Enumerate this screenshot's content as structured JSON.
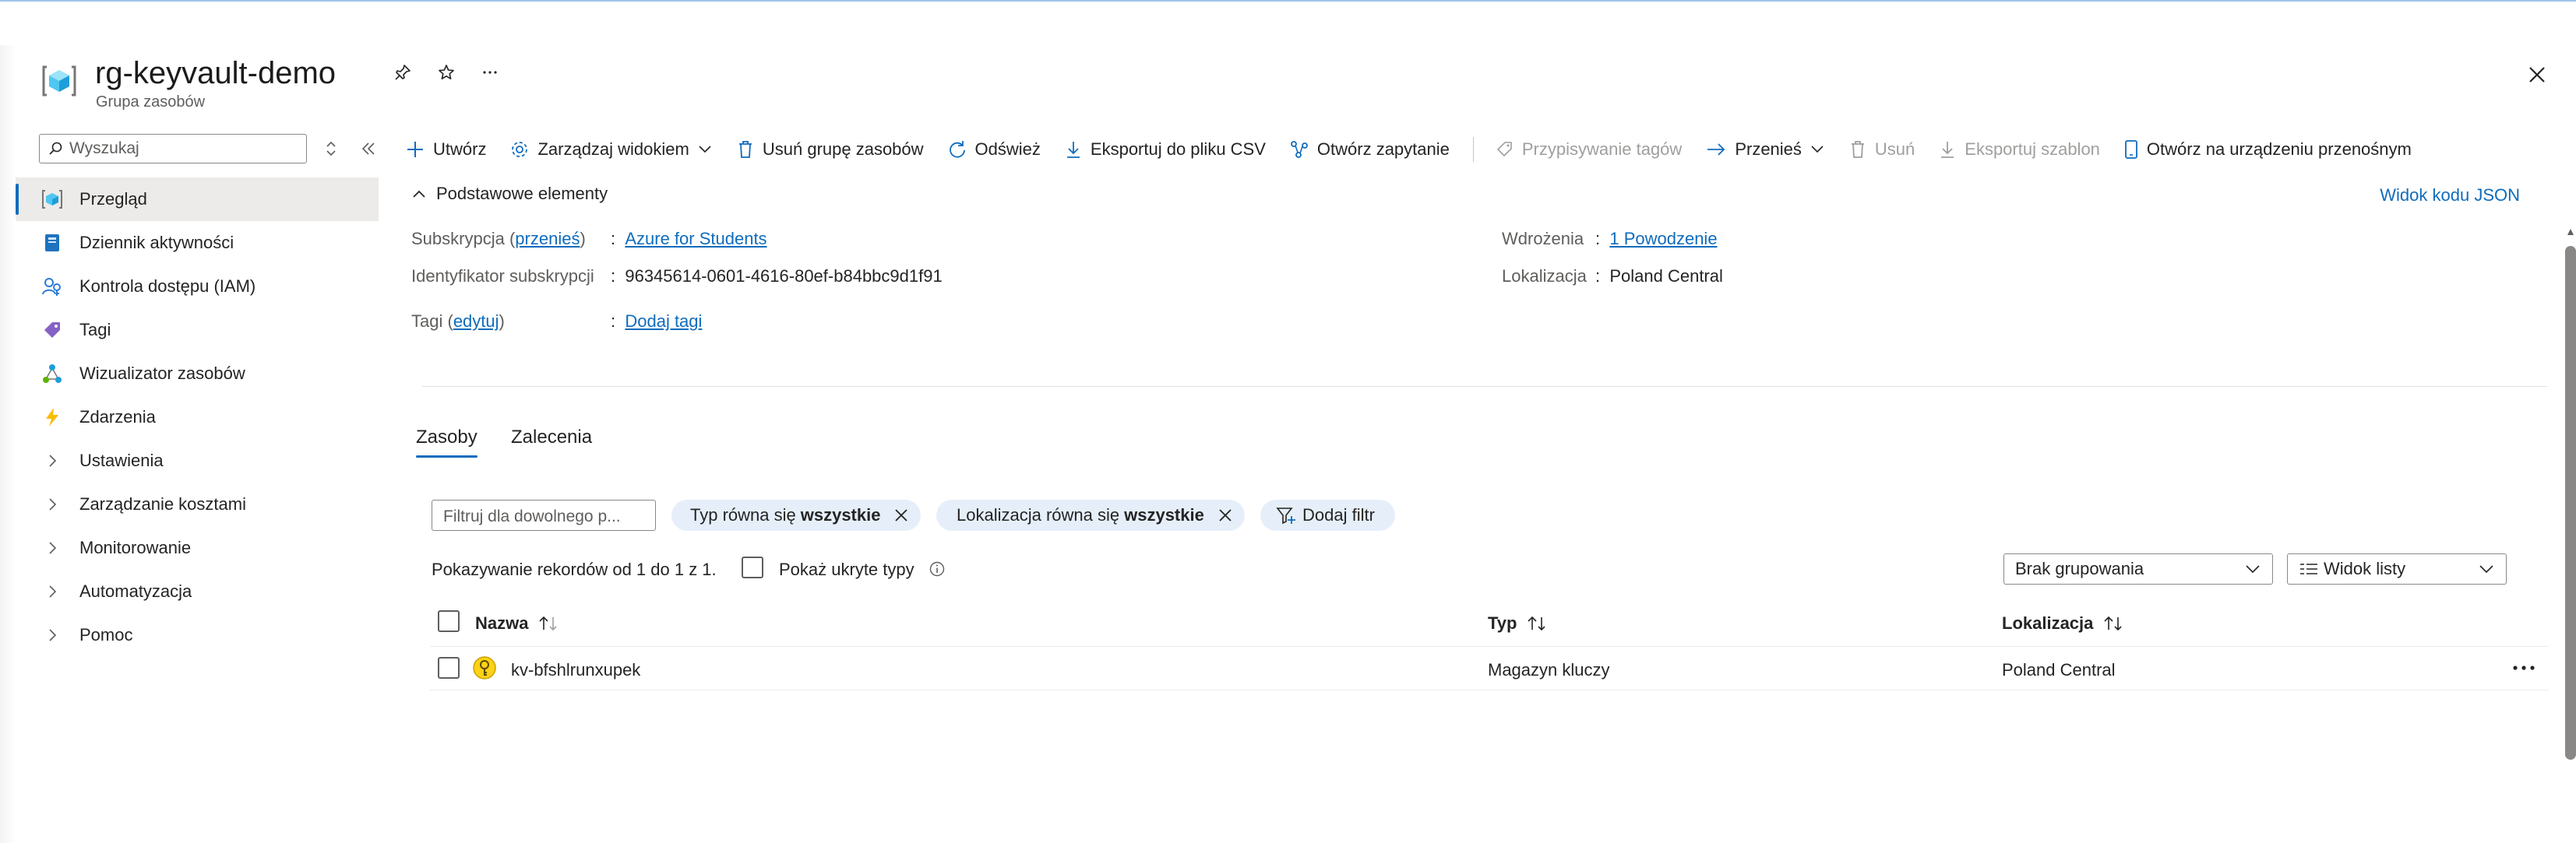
{
  "header": {
    "title": "rg-keyvault-demo",
    "subtitle": "Grupa zasobów",
    "icons": [
      "resource-group-icon",
      "pin-icon",
      "star-icon",
      "more-icon",
      "close-icon"
    ]
  },
  "sidebar": {
    "search_placeholder": "Wyszukaj",
    "items": [
      {
        "label": "Przegląd",
        "icon": "overview-icon",
        "active": true
      },
      {
        "label": "Dziennik aktywności",
        "icon": "activity-log-icon"
      },
      {
        "label": "Kontrola dostępu (IAM)",
        "icon": "iam-icon"
      },
      {
        "label": "Tagi",
        "icon": "tag-icon"
      },
      {
        "label": "Wizualizator zasobów",
        "icon": "visualizer-icon"
      },
      {
        "label": "Zdarzenia",
        "icon": "events-icon"
      },
      {
        "label": "Ustawienia",
        "icon": "chevron-right-icon"
      },
      {
        "label": "Zarządzanie kosztami",
        "icon": "chevron-right-icon"
      },
      {
        "label": "Monitorowanie",
        "icon": "chevron-right-icon"
      },
      {
        "label": "Automatyzacja",
        "icon": "chevron-right-icon"
      },
      {
        "label": "Pomoc",
        "icon": "chevron-right-icon"
      }
    ]
  },
  "toolbar": {
    "create": "Utwórz",
    "manage_view": "Zarządzaj widokiem",
    "delete_group": "Usuń grupę zasobów",
    "refresh": "Odśwież",
    "export_csv": "Eksportuj do pliku CSV",
    "open_query": "Otwórz zapytanie",
    "assign_tags": "Przypisywanie tagów",
    "move": "Przenieś",
    "delete": "Usuń",
    "export_template": "Eksportuj szablon",
    "open_mobile": "Otwórz na urządzeniu przenośnym"
  },
  "essentials": {
    "heading": "Podstawowe elementy",
    "json_view": "Widok kodu JSON",
    "subscription_label": "Subskrypcja",
    "subscription_move": "przenieś",
    "subscription_value": "Azure for Students",
    "subscription_id_label": "Identyfikator subskrypcji",
    "subscription_id_value": "96345614-0601-4616-80ef-b84bbc9d1f91",
    "tags_label": "Tagi",
    "tags_edit": "edytuj",
    "tags_value": "Dodaj tagi",
    "deployments_label": "Wdrożenia",
    "deployments_value": "1 Powodzenie",
    "location_label": "Lokalizacja",
    "location_value": "Poland Central"
  },
  "tabs": {
    "resources": "Zasoby",
    "recommendations": "Zalecenia"
  },
  "filters": {
    "placeholder": "Filtruj dla dowolnego p...",
    "type_prefix": "Typ równa się",
    "type_value": "wszystkie",
    "location_prefix": "Lokalizacja równa się",
    "location_value": "wszystkie",
    "add_filter": "Dodaj filtr"
  },
  "list": {
    "records_text": "Pokazywanie rekordów od 1 do 1 z 1.",
    "show_hidden": "Pokaż ukryte typy",
    "grouping": "Brak grupowania",
    "view_mode": "Widok listy",
    "columns": {
      "name": "Nazwa",
      "type": "Typ",
      "location": "Lokalizacja"
    },
    "rows": [
      {
        "name": "kv-bfshlrunxupek",
        "type": "Magazyn kluczy",
        "location": "Poland Central",
        "icon": "key-vault-icon"
      }
    ]
  },
  "colors": {
    "accent": "#0f6cbd",
    "pill": "#e6eff9",
    "selected": "#edebe9"
  }
}
